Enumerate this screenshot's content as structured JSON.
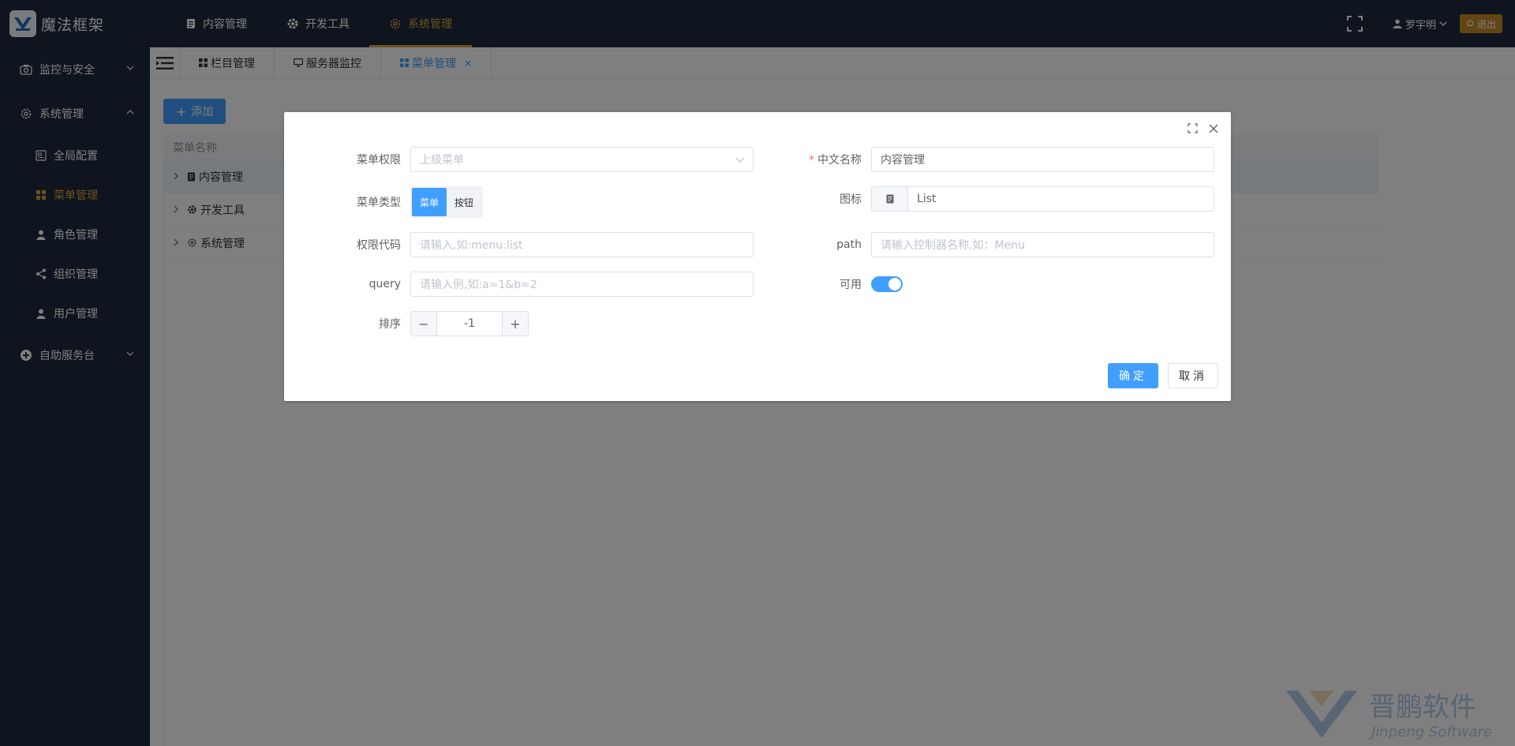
{
  "app": {
    "title": "魔法框架"
  },
  "topnav": [
    {
      "label": "内容管理",
      "icon": "document-icon"
    },
    {
      "label": "开发工具",
      "icon": "gear-icon"
    },
    {
      "label": "系统管理",
      "icon": "settings-icon",
      "active": true
    }
  ],
  "user": {
    "name": "罗宇明",
    "logout": "退出"
  },
  "sidebar": {
    "items": [
      {
        "label": "监控与安全",
        "icon": "camera-icon",
        "expanded": false
      },
      {
        "label": "系统管理",
        "icon": "settings-icon",
        "expanded": true,
        "children": [
          {
            "label": "全局配置",
            "icon": "config-icon"
          },
          {
            "label": "菜单管理",
            "icon": "grid-icon",
            "active": true
          },
          {
            "label": "角色管理",
            "icon": "person-icon"
          },
          {
            "label": "组织管理",
            "icon": "share-icon"
          },
          {
            "label": "用户管理",
            "icon": "person-icon"
          }
        ]
      },
      {
        "label": "自助服务台",
        "icon": "plus-circle-icon",
        "expanded": false
      }
    ]
  },
  "tabs": [
    {
      "label": "栏目管理",
      "icon": "grid-icon"
    },
    {
      "label": "服务器监控",
      "icon": "monitor-icon"
    },
    {
      "label": "菜单管理",
      "icon": "grid-icon",
      "active": true,
      "close": "×"
    }
  ],
  "main": {
    "add_button": "添加",
    "add_icon": "+",
    "table": {
      "header": "菜单名称",
      "rows": [
        {
          "label": "内容管理",
          "icon": "document-icon"
        },
        {
          "label": "开发工具",
          "icon": "gear-icon"
        },
        {
          "label": "系统管理",
          "icon": "settings-icon"
        }
      ]
    }
  },
  "watermark": {
    "cn": "晋鹏软件",
    "en": "Jinpeng Software"
  },
  "dialog": {
    "parent_menu": {
      "label": "菜单权限",
      "placeholder": "上级菜单"
    },
    "cn_name": {
      "label": "中文名称",
      "required": "*",
      "value": "内容管理"
    },
    "menu_type": {
      "label": "菜单类型",
      "options": [
        "菜单",
        "按钮"
      ],
      "selected": "菜单"
    },
    "icon": {
      "label": "图标",
      "value": "List"
    },
    "perm_code": {
      "label": "权限代码",
      "placeholder": "请输入,如:menu:list"
    },
    "path": {
      "label": "path",
      "placeholder": "请输入控制器名称,如：Menu"
    },
    "query": {
      "label": "query",
      "placeholder": "请输入例,如:a=1&b=2"
    },
    "enabled": {
      "label": "可用",
      "on": true
    },
    "sort": {
      "label": "排序",
      "value": "-1",
      "minus": "−",
      "plus": "+"
    },
    "ok": "确定",
    "cancel": "取消"
  }
}
